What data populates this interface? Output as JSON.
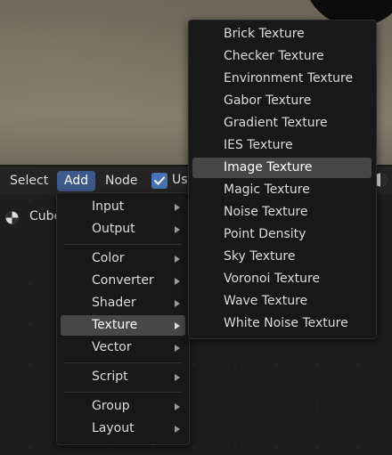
{
  "header": {
    "menus": [
      "Select",
      "Add",
      "Node"
    ],
    "use_label": "Use",
    "use_checked": true
  },
  "breadcrumb": {
    "object": "Cube"
  },
  "add_menu": {
    "groups": [
      [
        "Input",
        "Output"
      ],
      [
        "Color",
        "Converter",
        "Shader",
        "Texture",
        "Vector"
      ],
      [
        "Script"
      ],
      [
        "Group",
        "Layout"
      ]
    ],
    "highlighted": "Texture"
  },
  "texture_submenu": {
    "items": [
      "Brick Texture",
      "Checker Texture",
      "Environment Texture",
      "Gabor Texture",
      "Gradient Texture",
      "IES Texture",
      "Image Texture",
      "Magic Texture",
      "Noise Texture",
      "Point Density",
      "Sky Texture",
      "Voronoi Texture",
      "Wave Texture",
      "White Noise Texture"
    ],
    "highlighted": "Image Texture"
  },
  "colors": {
    "accent": "#4772b3",
    "active_menu": "#3e5a8a",
    "highlight": "#474747",
    "menu_bg": "#181818"
  }
}
